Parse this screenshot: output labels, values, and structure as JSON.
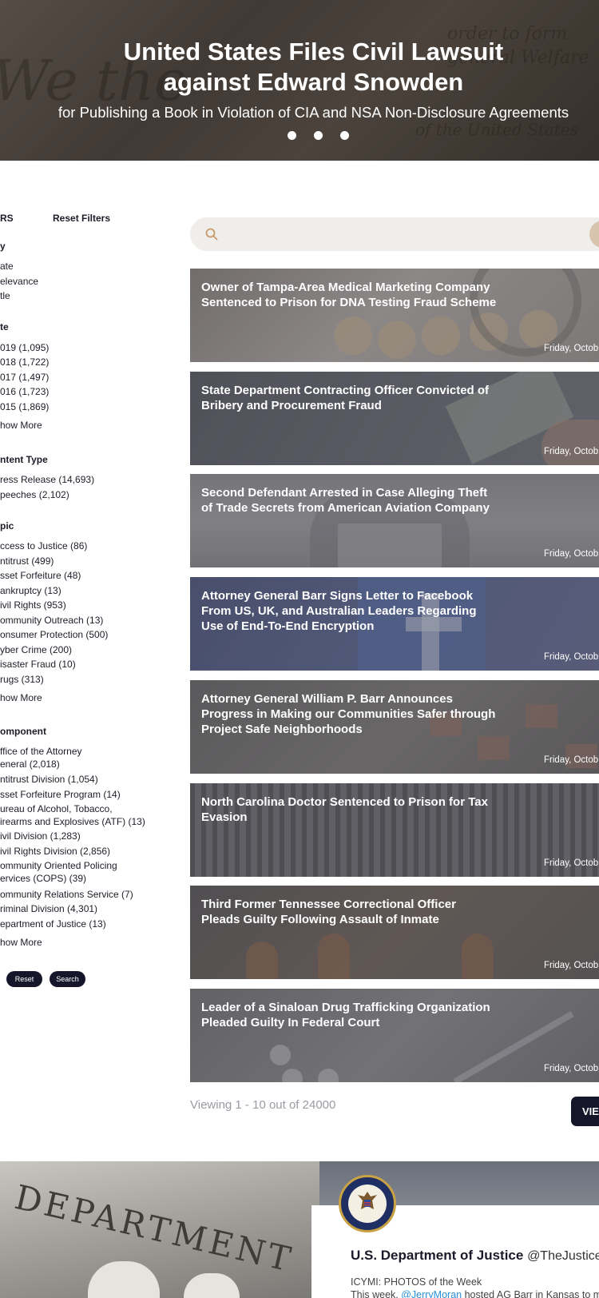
{
  "hero": {
    "title_line1": "United States Files Civil Lawsuit",
    "title_line2": "against Edward Snowden",
    "subtitle": "for Publishing a Book in Violation of CIA and NSA Non-Disclosure Agreements",
    "slide_count": 3
  },
  "sidebar": {
    "filters_label": "RS",
    "reset_filters_label": "Reset Filters",
    "sort": {
      "heading": "y",
      "options": [
        "ate",
        "elevance",
        "tle"
      ]
    },
    "date": {
      "heading": "te",
      "options": [
        "019 (1,095)",
        "018 (1,722)",
        "017 (1,497)",
        "016 (1,723)",
        "015 (1,869)"
      ],
      "show_more": "how More"
    },
    "content_type": {
      "heading": "ntent Type",
      "options": [
        "ress Release (14,693)",
        "peeches (2,102)"
      ]
    },
    "topic": {
      "heading": "pic",
      "options": [
        "ccess to Justice (86)",
        "ntitrust (499)",
        "sset Forfeiture (48)",
        "ankruptcy (13)",
        "ivil Rights (953)",
        "ommunity Outreach (13)",
        "onsumer Protection (500)",
        "yber Crime (200)",
        "isaster Fraud (10)",
        "rugs (313)"
      ],
      "show_more": "how More"
    },
    "component": {
      "heading": "omponent",
      "options": [
        [
          "ffice of the Attorney",
          "eneral (2,018)"
        ],
        [
          "ntitrust Division (1,054)"
        ],
        [
          "sset Forfeiture Program (14)"
        ],
        [
          "ureau of Alcohol, Tobacco,",
          "irearms and Explosives (ATF) (13)"
        ],
        [
          "ivil Division (1,283)"
        ],
        [
          "ivil Rights Division (2,856)"
        ],
        [
          "ommunity Oriented Policing",
          "ervices (COPS) (39)"
        ],
        [
          "ommunity Relations Service (7)"
        ],
        [
          "riminal Division (4,301)"
        ],
        [
          "epartment of Justice (13)"
        ]
      ],
      "show_more": "how More"
    },
    "reset_button": "Reset",
    "search_button": "Search"
  },
  "search": {
    "placeholder": ""
  },
  "news": [
    {
      "title": "Owner of Tampa-Area Medical Marketing Company Sentenced to Prison for DNA Testing Fraud Scheme",
      "date": "Friday, Octob",
      "theme": "fraud"
    },
    {
      "title": "State Department Contracting Officer Convicted of Bribery and Procurement Fraud",
      "date": "Friday, Octob",
      "theme": "money"
    },
    {
      "title": "Second Defendant Arrested in Case Alleging Theft of Trade Secrets from American Aviation Company",
      "date": "Friday, Octob",
      "theme": "laptop"
    },
    {
      "title": "Attorney General Barr Signs Letter to Facebook From US, UK, and Australian Leaders Regarding Use of End-To-End Encryption",
      "date": "Friday, Octob",
      "theme": "facebook"
    },
    {
      "title": "Attorney General William P. Barr Announces Progress in Making our Communities Safer through Project Safe Neighborhoods",
      "date": "Friday, Octob",
      "theme": "neighborhood"
    },
    {
      "title": "North Carolina Doctor Sentenced to Prison for Tax Evasion",
      "date": "Friday, Octob",
      "theme": "prison"
    },
    {
      "title": "Third Former Tennessee Correctional Officer Pleads Guilty Following Assault of Inmate",
      "date": "Friday, Octob",
      "theme": "inmates"
    },
    {
      "title": "Leader of a Sinaloan Drug Trafficking Organization Pleaded Guilty In Federal Court",
      "date": "Friday, Octob",
      "theme": "pills"
    }
  ],
  "pagination": {
    "viewing": "Viewing 1 - 10 out of 24000",
    "view_all": "VIEW"
  },
  "footer": {
    "building_text": "DEPARTMENT",
    "twitter": {
      "name": "U.S. Department of Justice",
      "handle": "@TheJusticeDe",
      "line1": "ICYMI: PHOTOS of the Week",
      "line2_prefix": "This week, ",
      "line2_link": "@JerryMoran",
      "line2_suffix": " hosted AG Barr in Kansas to m"
    }
  },
  "colors": {
    "dark_button": "#16162a",
    "search_bg": "#efeeeb",
    "search_accent": "#d8c3ae",
    "link": "#2a8fd6"
  }
}
